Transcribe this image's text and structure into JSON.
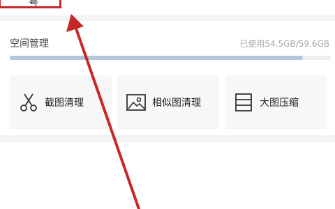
{
  "top": {
    "partial_text": "号"
  },
  "space": {
    "title": "空间管理",
    "usage": "已使用54.5GB/59.6GB",
    "used_fraction": 0.914
  },
  "tools": [
    {
      "label": "截图清理",
      "icon": "scissors-icon"
    },
    {
      "label": "相似图清理",
      "icon": "image-icon"
    },
    {
      "label": "大图压缩",
      "icon": "compress-icon"
    }
  ],
  "annotation": {
    "highlight_color": "#c62828"
  }
}
